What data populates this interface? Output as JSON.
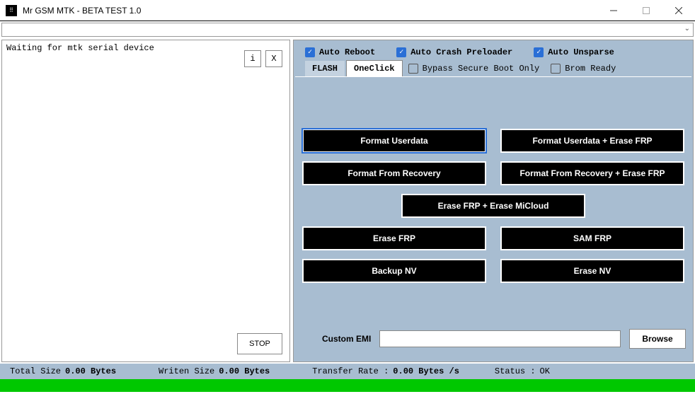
{
  "window": {
    "title": "Mr GSM MTK - BETA TEST 1.0"
  },
  "log": {
    "text": "Waiting for mtk serial device"
  },
  "mini_buttons": {
    "info": "i",
    "clear": "X"
  },
  "stop_label": "STOP",
  "checkboxes": {
    "auto_reboot": {
      "label": "Auto Reboot",
      "checked": true
    },
    "auto_crash": {
      "label": "Auto Crash Preloader",
      "checked": true
    },
    "auto_unsparse": {
      "label": "Auto Unsparse",
      "checked": true
    },
    "bypass_secure": {
      "label": "Bypass Secure Boot Only",
      "checked": false
    },
    "brom_ready": {
      "label": "Brom Ready",
      "checked": false
    }
  },
  "tabs": {
    "flash": "FLASH",
    "oneclick": "OneClick"
  },
  "actions": {
    "format_userdata": "Format Userdata",
    "format_userdata_frp": "Format Userdata + Erase FRP",
    "format_recovery": "Format From Recovery",
    "format_recovery_frp": "Format From Recovery + Erase FRP",
    "erase_frp_micloud": "Erase FRP + Erase MiCloud",
    "erase_frp": "Erase FRP",
    "sam_frp": "SAM FRP",
    "backup_nv": "Backup NV",
    "erase_nv": "Erase NV"
  },
  "emi": {
    "label": "Custom EMI",
    "value": "",
    "browse": "Browse"
  },
  "status": {
    "total_size_label": "Total Size",
    "total_size_value": "0.00 Bytes",
    "written_size_label": "Writen Size",
    "written_size_value": "0.00 Bytes",
    "transfer_rate_label": "Transfer Rate :",
    "transfer_rate_value": "0.00 Bytes /s",
    "status_label": "Status :",
    "status_value": "OK"
  }
}
